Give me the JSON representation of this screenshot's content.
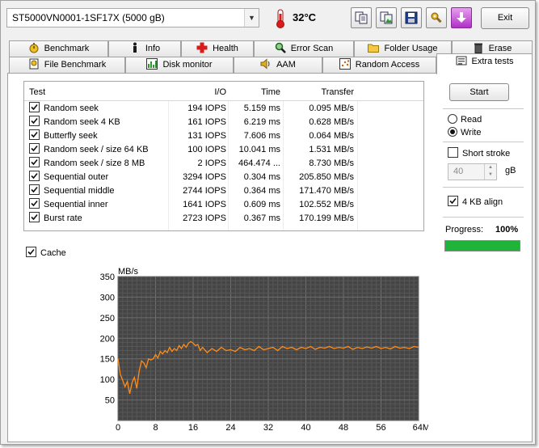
{
  "drive": {
    "selected": "ST5000VN0001-1SF17X (5000 gB)"
  },
  "temperature": "32°C",
  "toolbar": {
    "exit_label": "Exit"
  },
  "tabs_row1": [
    "Benchmark",
    "Info",
    "Health",
    "Error Scan",
    "Folder Usage",
    "Erase"
  ],
  "tabs_row2": [
    "File Benchmark",
    "Disk monitor",
    "AAM",
    "Random Access",
    "Extra tests"
  ],
  "active_tab": "Extra tests",
  "results": {
    "headers": {
      "test": "Test",
      "io": "I/O",
      "time": "Time",
      "transfer": "Transfer"
    },
    "rows": [
      {
        "test": "Random seek",
        "io": "194 IOPS",
        "time": "5.159 ms",
        "transfer": "0.095 MB/s",
        "checked": true
      },
      {
        "test": "Random seek 4 KB",
        "io": "161 IOPS",
        "time": "6.219 ms",
        "transfer": "0.628 MB/s",
        "checked": true
      },
      {
        "test": "Butterfly seek",
        "io": "131 IOPS",
        "time": "7.606 ms",
        "transfer": "0.064 MB/s",
        "checked": true
      },
      {
        "test": "Random seek / size 64 KB",
        "io": "100 IOPS",
        "time": "10.041 ms",
        "transfer": "1.531 MB/s",
        "checked": true
      },
      {
        "test": "Random seek / size 8 MB",
        "io": "2 IOPS",
        "time": "464.474 ...",
        "transfer": "8.730 MB/s",
        "checked": true
      },
      {
        "test": "Sequential outer",
        "io": "3294 IOPS",
        "time": "0.304 ms",
        "transfer": "205.850 MB/s",
        "checked": true
      },
      {
        "test": "Sequential middle",
        "io": "2744 IOPS",
        "time": "0.364 ms",
        "transfer": "171.470 MB/s",
        "checked": true
      },
      {
        "test": "Sequential inner",
        "io": "1641 IOPS",
        "time": "0.609 ms",
        "transfer": "102.552 MB/s",
        "checked": true
      },
      {
        "test": "Burst rate",
        "io": "2723 IOPS",
        "time": "0.367 ms",
        "transfer": "170.199 MB/s",
        "checked": true
      }
    ]
  },
  "cache": {
    "label": "Cache",
    "checked": true
  },
  "controls": {
    "start_label": "Start",
    "read_label": "Read",
    "write_label": "Write",
    "mode": "write",
    "short_stroke_label": "Short stroke",
    "short_stroke_checked": false,
    "stroke_value": "40",
    "stroke_unit": "gB",
    "kb4_align_label": "4 KB align",
    "kb4_align_checked": true,
    "progress_label": "Progress:",
    "progress_value": "100%",
    "progress_fraction": 1.0,
    "progress_color": "#1fb33a"
  },
  "chart_data": {
    "type": "line",
    "ylabel": "MB/s",
    "xlabel": "",
    "x_unit_label": "MB",
    "xlim": [
      0,
      64
    ],
    "ylim": [
      0,
      350
    ],
    "yticks": [
      50,
      100,
      150,
      200,
      250,
      300,
      350
    ],
    "xticks": [
      0,
      8,
      16,
      24,
      32,
      40,
      48,
      56,
      64
    ],
    "grid": true,
    "background": "#454545",
    "line_color": "#ff8c1a",
    "series": [
      {
        "x": [
          0,
          0.5,
          1,
          1.5,
          2,
          2.5,
          3,
          3.5,
          4,
          4.5,
          5,
          5.5,
          6,
          6.5,
          7,
          7.5,
          8,
          8.5,
          9,
          9.5,
          10,
          10.5,
          11,
          11.5,
          12,
          12.5,
          13,
          13.5,
          14,
          14.5,
          15,
          15.5,
          16,
          16.5,
          17,
          17.5,
          18,
          19,
          20,
          21,
          22,
          23,
          24,
          25,
          26,
          27,
          28,
          29,
          30,
          31,
          32,
          33,
          34,
          35,
          36,
          37,
          38,
          39,
          40,
          41,
          42,
          43,
          44,
          45,
          46,
          47,
          48,
          49,
          50,
          51,
          52,
          53,
          54,
          55,
          56,
          57,
          58,
          59,
          60,
          61,
          62,
          63,
          64
        ],
        "y": [
          150,
          112,
          98,
          82,
          95,
          65,
          92,
          105,
          78,
          120,
          145,
          140,
          128,
          150,
          147,
          150,
          160,
          152,
          168,
          162,
          170,
          165,
          178,
          168,
          175,
          170,
          182,
          175,
          185,
          178,
          188,
          192,
          188,
          182,
          185,
          170,
          178,
          165,
          175,
          168,
          178,
          170,
          172,
          168,
          178,
          172,
          175,
          170,
          180,
          172,
          175,
          178,
          170,
          180,
          175,
          178,
          172,
          178,
          175,
          180,
          173,
          178,
          176,
          180,
          175,
          178,
          176,
          180,
          173,
          178,
          175,
          179,
          176,
          180,
          175,
          178,
          174,
          180,
          176,
          178,
          175,
          180,
          178
        ]
      }
    ]
  }
}
